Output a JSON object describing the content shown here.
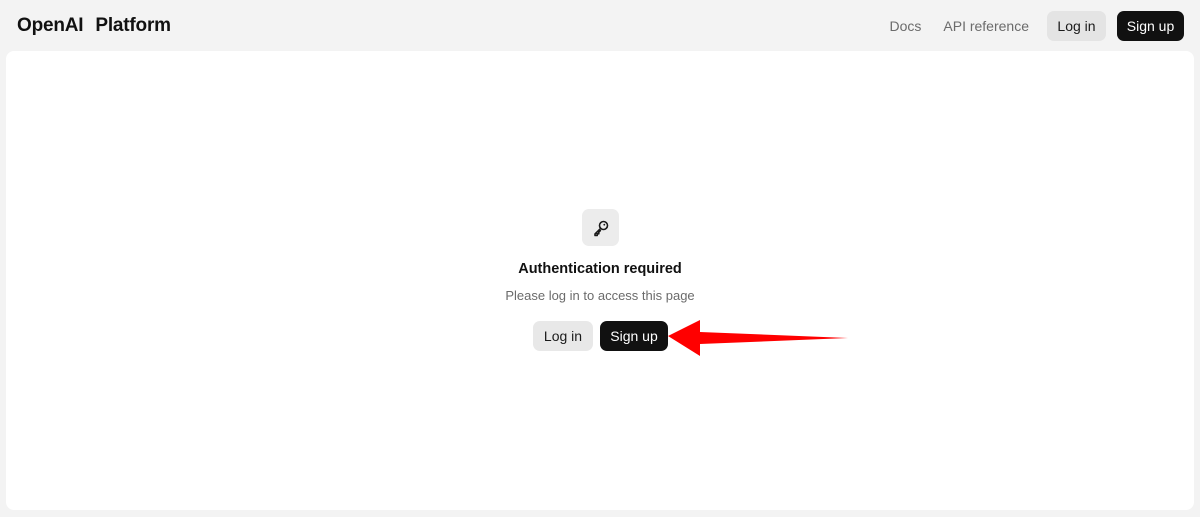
{
  "header": {
    "brand_name": "OpenAI",
    "brand_product": "Platform",
    "nav": {
      "docs_label": "Docs",
      "api_reference_label": "API reference"
    },
    "login_label": "Log in",
    "signup_label": "Sign up"
  },
  "auth_panel": {
    "icon": "key-icon",
    "title": "Authentication required",
    "message": "Please log in to access this page",
    "login_label": "Log in",
    "signup_label": "Sign up"
  },
  "annotation": {
    "arrow_color": "#ff0000",
    "arrow_target": "signup-button"
  },
  "colors": {
    "primary_button": "#111111",
    "secondary_button": "#e8e8e8",
    "page_background": "#f3f3f3",
    "panel_background": "#ffffff"
  }
}
